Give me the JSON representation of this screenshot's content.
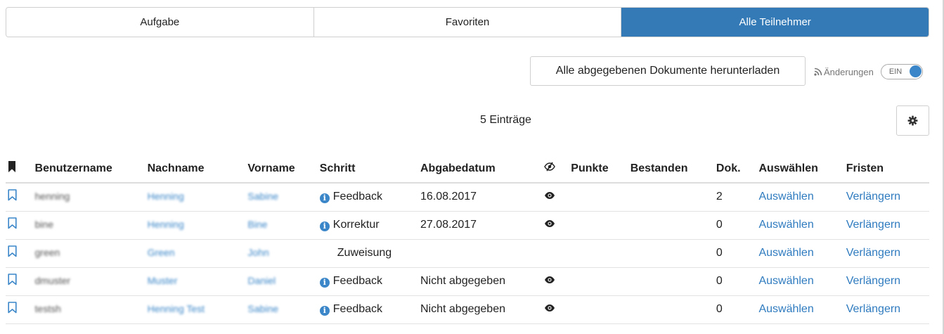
{
  "tabs": [
    {
      "label": "Aufgabe",
      "active": false
    },
    {
      "label": "Favoriten",
      "active": false
    },
    {
      "label": "Alle Teilnehmer",
      "active": true
    }
  ],
  "download_button": "Alle abgegebenen Dokumente herunterladen",
  "changes": {
    "label": "Änderungen",
    "toggle_label": "EIN",
    "toggle_on": true
  },
  "entries_count": "5 Einträge",
  "settings_icon": "gear-icon",
  "table": {
    "headers": {
      "bookmark": "bookmark-filled-icon",
      "username": "Benutzername",
      "lastname": "Nachname",
      "firstname": "Vorname",
      "step": "Schritt",
      "date": "Abgabedatum",
      "visibility": "eye-slash-icon",
      "points": "Punkte",
      "passed": "Bestanden",
      "docs": "Dok.",
      "select": "Auswählen",
      "deadlines": "Fristen"
    },
    "rows": [
      {
        "username": "henning",
        "lastname": "Henning",
        "firstname": "Sabine",
        "step": "Feedback",
        "step_icon": true,
        "date": "16.08.2017",
        "eye": true,
        "points": "",
        "passed": "",
        "docs": "2",
        "select": "Auswählen",
        "extend": "Verlängern"
      },
      {
        "username": "bine",
        "lastname": "Henning",
        "firstname": "Bine",
        "step": "Korrektur",
        "step_icon": true,
        "date": "27.08.2017",
        "eye": true,
        "points": "",
        "passed": "",
        "docs": "0",
        "select": "Auswählen",
        "extend": "Verlängern"
      },
      {
        "username": "green",
        "lastname": "Green",
        "firstname": "John",
        "step": "Zuweisung",
        "step_icon": false,
        "date": "",
        "eye": false,
        "points": "",
        "passed": "",
        "docs": "0",
        "select": "Auswählen",
        "extend": "Verlängern"
      },
      {
        "username": "dmuster",
        "lastname": "Muster",
        "firstname": "Daniel",
        "step": "Feedback",
        "step_icon": true,
        "date": "Nicht abgegeben",
        "eye": true,
        "points": "",
        "passed": "",
        "docs": "0",
        "select": "Auswählen",
        "extend": "Verlängern"
      },
      {
        "username": "testsh",
        "lastname": "Henning Test",
        "firstname": "Sabine",
        "step": "Feedback",
        "step_icon": true,
        "date": "Nicht abgegeben",
        "eye": true,
        "points": "",
        "passed": "",
        "docs": "0",
        "select": "Auswählen",
        "extend": "Verlängern"
      }
    ]
  },
  "colors": {
    "accent": "#337ab7",
    "link": "#2f7bbf"
  }
}
